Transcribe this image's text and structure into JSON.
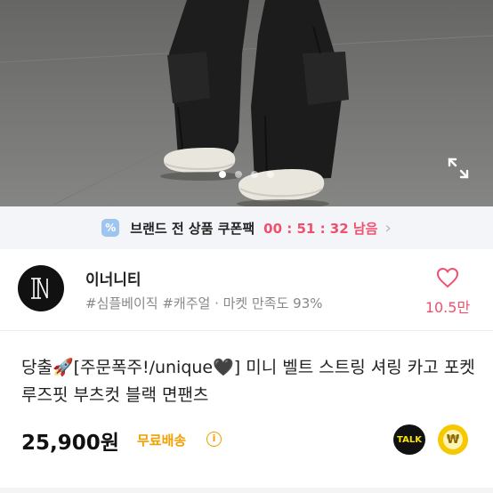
{
  "product_image": {
    "alt": "black cargo pants with white shoes",
    "slide_count": 4,
    "active_slide": 1,
    "expand_icon": "expand-icon"
  },
  "coupon": {
    "icon": "coupon-icon",
    "text": "브랜드 전 상품 쿠폰팩",
    "timer": "00 : 51 : 32 남음",
    "chevron": "›"
  },
  "seller": {
    "name": "이너니티",
    "tags": "#심플베이직 #캐주얼 · 마켓 만족도 93%",
    "likes": "10.5만",
    "heart_icon": "heart-icon"
  },
  "product": {
    "title": "당출🚀[주문폭주!/unique🖤] 미니 벨트 스트링 셔링 카고 포켓 루즈핏 부츠컷 블랙 면팬츠",
    "price": "25,900원",
    "shipping": "무료배송",
    "info_icon": "ⓘ",
    "talk_label": "TALK",
    "pay_symbol": "₩"
  },
  "colors": {
    "accent_pink": "#f0506e",
    "shipping_orange": "#f0a000",
    "kakao_yellow": "#f5c800"
  }
}
